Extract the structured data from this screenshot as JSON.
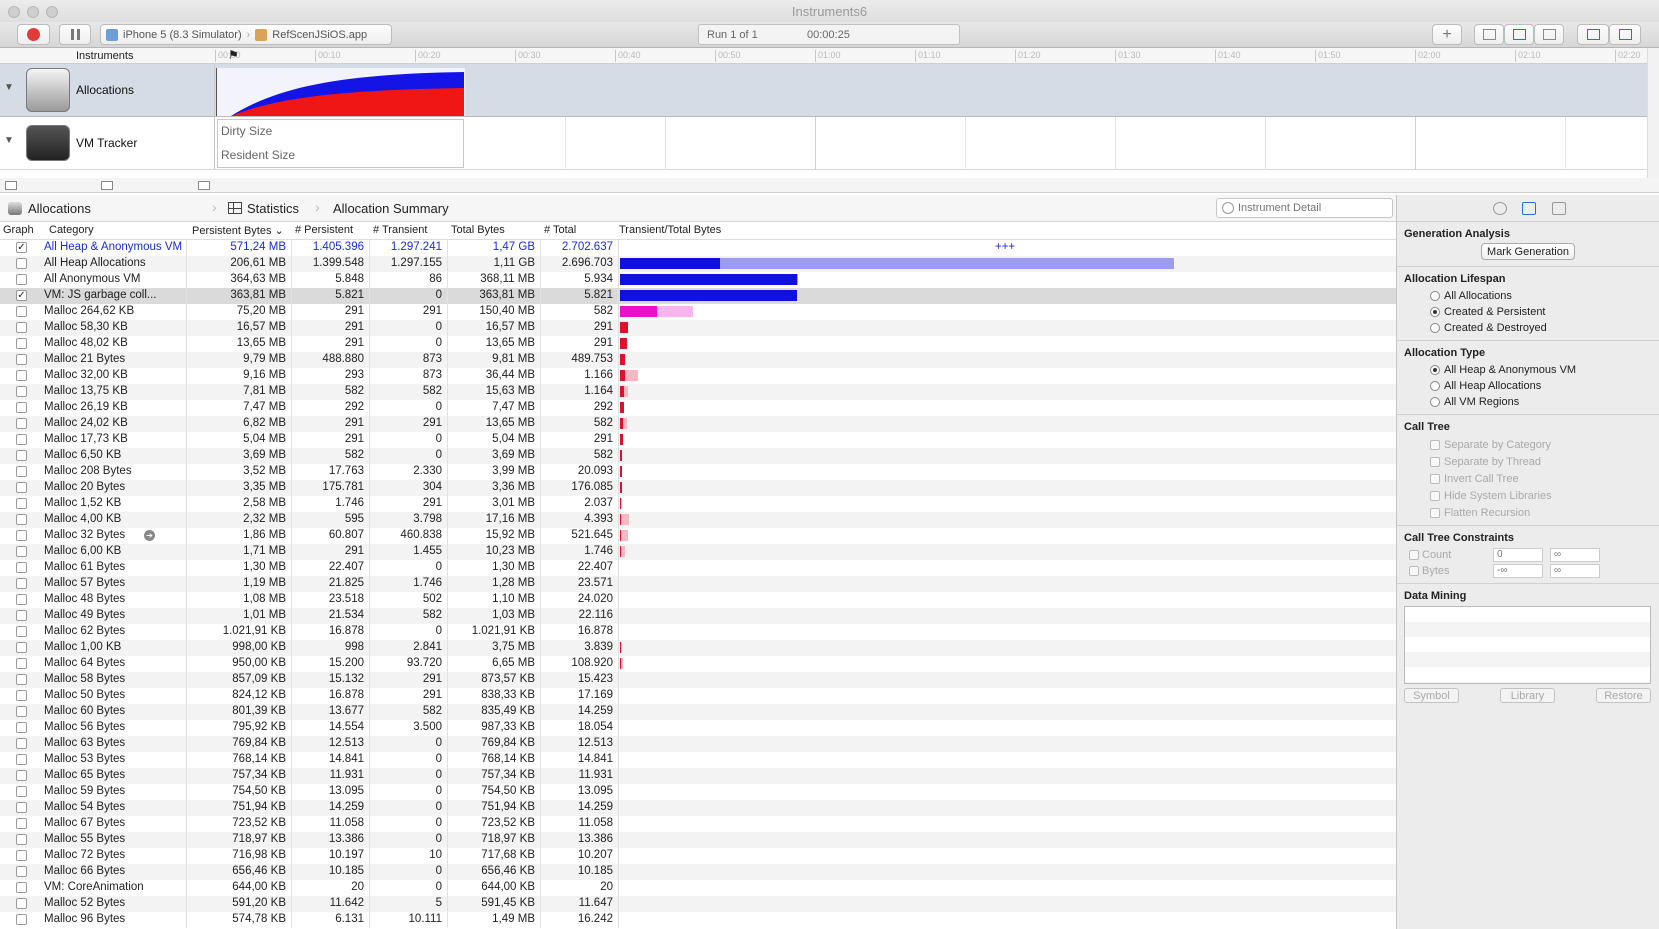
{
  "window": {
    "title": "Instruments6"
  },
  "toolbar": {
    "device": "iPhone 5 (8.3 Simulator)",
    "app": "RefScenJSiOS.app",
    "run_label": "Run 1 of 1",
    "run_time": "00:00:25"
  },
  "timeline": {
    "header": "Instruments",
    "ticks": [
      "00:00",
      "00:10",
      "00:20",
      "00:30",
      "00:40",
      "00:50",
      "01:00",
      "01:10",
      "01:20",
      "01:30",
      "01:40",
      "01:50",
      "02:00",
      "02:10",
      "02:20"
    ],
    "tracks": [
      {
        "name": "Allocations"
      },
      {
        "name": "VM Tracker",
        "labels": [
          "Dirty Size",
          "Resident Size"
        ]
      }
    ]
  },
  "jumpbar": {
    "instrument": "Allocations",
    "view": "Statistics",
    "summary": "Allocation Summary"
  },
  "search": {
    "placeholder": "Instrument Detail"
  },
  "columns": [
    "Graph",
    "Category",
    "Persistent Bytes",
    "# Persistent",
    "# Transient",
    "Total Bytes",
    "# Total",
    "Transient/Total Bytes"
  ],
  "plus_marker": "+++",
  "rows": [
    {
      "checked": true,
      "category": "All Heap & Anonymous VM",
      "persistent_bytes": "571,24 MB",
      "persistent": "1.405.396",
      "transient": "1.297.241",
      "total_bytes": "1,47 GB",
      "total": "2.702.637",
      "highlight": true,
      "bar_dark": 0,
      "bar_light": 0
    },
    {
      "checked": false,
      "category": "All Heap Allocations",
      "persistent_bytes": "206,61 MB",
      "persistent": "1.399.548",
      "transient": "1.297.155",
      "total_bytes": "1,11 GB",
      "total": "2.696.703",
      "color": "blue",
      "bar_dark": 100,
      "bar_light": 554
    },
    {
      "checked": false,
      "category": "All Anonymous VM",
      "persistent_bytes": "364,63 MB",
      "persistent": "5.848",
      "transient": "86",
      "total_bytes": "368,11 MB",
      "total": "5.934",
      "color": "blue",
      "bar_dark": 177,
      "bar_light": 178
    },
    {
      "checked": true,
      "category": "VM: JS garbage coll...",
      "persistent_bytes": "363,81 MB",
      "persistent": "5.821",
      "transient": "0",
      "total_bytes": "363,81 MB",
      "total": "5.821",
      "color": "blue",
      "bar_dark": 177,
      "bar_light": 177,
      "selected": true
    },
    {
      "checked": false,
      "category": "Malloc 264,62 KB",
      "persistent_bytes": "75,20 MB",
      "persistent": "291",
      "transient": "291",
      "total_bytes": "150,40 MB",
      "total": "582",
      "color": "magenta",
      "bar_dark": 37,
      "bar_light": 73
    },
    {
      "checked": false,
      "category": "Malloc 58,30 KB",
      "persistent_bytes": "16,57 MB",
      "persistent": "291",
      "transient": "0",
      "total_bytes": "16,57 MB",
      "total": "291",
      "color": "red",
      "bar_dark": 8,
      "bar_light": 8
    },
    {
      "checked": false,
      "category": "Malloc 48,02 KB",
      "persistent_bytes": "13,65 MB",
      "persistent": "291",
      "transient": "0",
      "total_bytes": "13,65 MB",
      "total": "291",
      "color": "red",
      "bar_dark": 7,
      "bar_light": 7
    },
    {
      "checked": false,
      "category": "Malloc 21 Bytes",
      "persistent_bytes": "9,79 MB",
      "persistent": "488.880",
      "transient": "873",
      "total_bytes": "9,81 MB",
      "total": "489.753",
      "color": "red",
      "bar_dark": 5,
      "bar_light": 5
    },
    {
      "checked": false,
      "category": "Malloc 32,00 KB",
      "persistent_bytes": "9,16 MB",
      "persistent": "293",
      "transient": "873",
      "total_bytes": "36,44 MB",
      "total": "1.166",
      "color": "red",
      "bar_dark": 5,
      "bar_light": 18
    },
    {
      "checked": false,
      "category": "Malloc 13,75 KB",
      "persistent_bytes": "7,81 MB",
      "persistent": "582",
      "transient": "582",
      "total_bytes": "15,63 MB",
      "total": "1.164",
      "color": "red",
      "bar_dark": 4,
      "bar_light": 8
    },
    {
      "checked": false,
      "category": "Malloc 26,19 KB",
      "persistent_bytes": "7,47 MB",
      "persistent": "292",
      "transient": "0",
      "total_bytes": "7,47 MB",
      "total": "292",
      "color": "red",
      "bar_dark": 4,
      "bar_light": 4
    },
    {
      "checked": false,
      "category": "Malloc 24,02 KB",
      "persistent_bytes": "6,82 MB",
      "persistent": "291",
      "transient": "291",
      "total_bytes": "13,65 MB",
      "total": "582",
      "color": "red",
      "bar_dark": 3,
      "bar_light": 7
    },
    {
      "checked": false,
      "category": "Malloc 17,73 KB",
      "persistent_bytes": "5,04 MB",
      "persistent": "291",
      "transient": "0",
      "total_bytes": "5,04 MB",
      "total": "291",
      "color": "red",
      "bar_dark": 3,
      "bar_light": 3
    },
    {
      "checked": false,
      "category": "Malloc 6,50 KB",
      "persistent_bytes": "3,69 MB",
      "persistent": "582",
      "transient": "0",
      "total_bytes": "3,69 MB",
      "total": "582",
      "color": "red",
      "bar_dark": 2,
      "bar_light": 2
    },
    {
      "checked": false,
      "category": "Malloc 208 Bytes",
      "persistent_bytes": "3,52 MB",
      "persistent": "17.763",
      "transient": "2.330",
      "total_bytes": "3,99 MB",
      "total": "20.093",
      "color": "red",
      "bar_dark": 2,
      "bar_light": 2
    },
    {
      "checked": false,
      "category": "Malloc 20 Bytes",
      "persistent_bytes": "3,35 MB",
      "persistent": "175.781",
      "transient": "304",
      "total_bytes": "3,36 MB",
      "total": "176.085",
      "color": "red",
      "bar_dark": 2,
      "bar_light": 2
    },
    {
      "checked": false,
      "category": "Malloc 1,52 KB",
      "persistent_bytes": "2,58 MB",
      "persistent": "1.746",
      "transient": "291",
      "total_bytes": "3,01 MB",
      "total": "2.037",
      "color": "red",
      "bar_dark": 1,
      "bar_light": 2
    },
    {
      "checked": false,
      "category": "Malloc 4,00 KB",
      "persistent_bytes": "2,32 MB",
      "persistent": "595",
      "transient": "3.798",
      "total_bytes": "17,16 MB",
      "total": "4.393",
      "color": "red",
      "bar_dark": 1,
      "bar_light": 9
    },
    {
      "checked": false,
      "category": "Malloc 32 Bytes",
      "persistent_bytes": "1,86 MB",
      "persistent": "60.807",
      "transient": "460.838",
      "total_bytes": "15,92 MB",
      "total": "521.645",
      "color": "red",
      "bar_dark": 1,
      "bar_light": 8,
      "arrow": true
    },
    {
      "checked": false,
      "category": "Malloc 6,00 KB",
      "persistent_bytes": "1,71 MB",
      "persistent": "291",
      "transient": "1.455",
      "total_bytes": "10,23 MB",
      "total": "1.746",
      "color": "red",
      "bar_dark": 1,
      "bar_light": 5
    },
    {
      "checked": false,
      "category": "Malloc 61 Bytes",
      "persistent_bytes": "1,30 MB",
      "persistent": "22.407",
      "transient": "0",
      "total_bytes": "1,30 MB",
      "total": "22.407",
      "color": "red",
      "bar_dark": 0,
      "bar_light": 0
    },
    {
      "checked": false,
      "category": "Malloc 57 Bytes",
      "persistent_bytes": "1,19 MB",
      "persistent": "21.825",
      "transient": "1.746",
      "total_bytes": "1,28 MB",
      "total": "23.571",
      "color": "red",
      "bar_dark": 0,
      "bar_light": 0
    },
    {
      "checked": false,
      "category": "Malloc 48 Bytes",
      "persistent_bytes": "1,08 MB",
      "persistent": "23.518",
      "transient": "502",
      "total_bytes": "1,10 MB",
      "total": "24.020",
      "color": "red",
      "bar_dark": 0,
      "bar_light": 0
    },
    {
      "checked": false,
      "category": "Malloc 49 Bytes",
      "persistent_bytes": "1,01 MB",
      "persistent": "21.534",
      "transient": "582",
      "total_bytes": "1,03 MB",
      "total": "22.116",
      "color": "red",
      "bar_dark": 0,
      "bar_light": 0
    },
    {
      "checked": false,
      "category": "Malloc 62 Bytes",
      "persistent_bytes": "1.021,91 KB",
      "persistent": "16.878",
      "transient": "0",
      "total_bytes": "1.021,91 KB",
      "total": "16.878",
      "color": "red",
      "bar_dark": 0,
      "bar_light": 0
    },
    {
      "checked": false,
      "category": "Malloc 1,00 KB",
      "persistent_bytes": "998,00 KB",
      "persistent": "998",
      "transient": "2.841",
      "total_bytes": "3,75 MB",
      "total": "3.839",
      "color": "red",
      "bar_dark": 0,
      "bar_light": 2
    },
    {
      "checked": false,
      "category": "Malloc 64 Bytes",
      "persistent_bytes": "950,00 KB",
      "persistent": "15.200",
      "transient": "93.720",
      "total_bytes": "6,65 MB",
      "total": "108.920",
      "color": "red",
      "bar_dark": 0,
      "bar_light": 3
    },
    {
      "checked": false,
      "category": "Malloc 58 Bytes",
      "persistent_bytes": "857,09 KB",
      "persistent": "15.132",
      "transient": "291",
      "total_bytes": "873,57 KB",
      "total": "15.423",
      "color": "red",
      "bar_dark": 0,
      "bar_light": 0
    },
    {
      "checked": false,
      "category": "Malloc 50 Bytes",
      "persistent_bytes": "824,12 KB",
      "persistent": "16.878",
      "transient": "291",
      "total_bytes": "838,33 KB",
      "total": "17.169",
      "color": "red",
      "bar_dark": 0,
      "bar_light": 0
    },
    {
      "checked": false,
      "category": "Malloc 60 Bytes",
      "persistent_bytes": "801,39 KB",
      "persistent": "13.677",
      "transient": "582",
      "total_bytes": "835,49 KB",
      "total": "14.259",
      "color": "red",
      "bar_dark": 0,
      "bar_light": 0
    },
    {
      "checked": false,
      "category": "Malloc 56 Bytes",
      "persistent_bytes": "795,92 KB",
      "persistent": "14.554",
      "transient": "3.500",
      "total_bytes": "987,33 KB",
      "total": "18.054",
      "color": "red",
      "bar_dark": 0,
      "bar_light": 0
    },
    {
      "checked": false,
      "category": "Malloc 63 Bytes",
      "persistent_bytes": "769,84 KB",
      "persistent": "12.513",
      "transient": "0",
      "total_bytes": "769,84 KB",
      "total": "12.513",
      "color": "red",
      "bar_dark": 0,
      "bar_light": 0
    },
    {
      "checked": false,
      "category": "Malloc 53 Bytes",
      "persistent_bytes": "768,14 KB",
      "persistent": "14.841",
      "transient": "0",
      "total_bytes": "768,14 KB",
      "total": "14.841",
      "color": "red",
      "bar_dark": 0,
      "bar_light": 0
    },
    {
      "checked": false,
      "category": "Malloc 65 Bytes",
      "persistent_bytes": "757,34 KB",
      "persistent": "11.931",
      "transient": "0",
      "total_bytes": "757,34 KB",
      "total": "11.931",
      "color": "red",
      "bar_dark": 0,
      "bar_light": 0
    },
    {
      "checked": false,
      "category": "Malloc 59 Bytes",
      "persistent_bytes": "754,50 KB",
      "persistent": "13.095",
      "transient": "0",
      "total_bytes": "754,50 KB",
      "total": "13.095",
      "color": "red",
      "bar_dark": 0,
      "bar_light": 0
    },
    {
      "checked": false,
      "category": "Malloc 54 Bytes",
      "persistent_bytes": "751,94 KB",
      "persistent": "14.259",
      "transient": "0",
      "total_bytes": "751,94 KB",
      "total": "14.259",
      "color": "red",
      "bar_dark": 0,
      "bar_light": 0
    },
    {
      "checked": false,
      "category": "Malloc 67 Bytes",
      "persistent_bytes": "723,52 KB",
      "persistent": "11.058",
      "transient": "0",
      "total_bytes": "723,52 KB",
      "total": "11.058",
      "color": "red",
      "bar_dark": 0,
      "bar_light": 0
    },
    {
      "checked": false,
      "category": "Malloc 55 Bytes",
      "persistent_bytes": "718,97 KB",
      "persistent": "13.386",
      "transient": "0",
      "total_bytes": "718,97 KB",
      "total": "13.386",
      "color": "red",
      "bar_dark": 0,
      "bar_light": 0
    },
    {
      "checked": false,
      "category": "Malloc 72 Bytes",
      "persistent_bytes": "716,98 KB",
      "persistent": "10.197",
      "transient": "10",
      "total_bytes": "717,68 KB",
      "total": "10.207",
      "color": "red",
      "bar_dark": 0,
      "bar_light": 0
    },
    {
      "checked": false,
      "category": "Malloc 66 Bytes",
      "persistent_bytes": "656,46 KB",
      "persistent": "10.185",
      "transient": "0",
      "total_bytes": "656,46 KB",
      "total": "10.185",
      "color": "red",
      "bar_dark": 0,
      "bar_light": 0
    },
    {
      "checked": false,
      "category": "VM: CoreAnimation",
      "persistent_bytes": "644,00 KB",
      "persistent": "20",
      "transient": "0",
      "total_bytes": "644,00 KB",
      "total": "20",
      "color": "red",
      "bar_dark": 0,
      "bar_light": 0
    },
    {
      "checked": false,
      "category": "Malloc 52 Bytes",
      "persistent_bytes": "591,20 KB",
      "persistent": "11.642",
      "transient": "5",
      "total_bytes": "591,45 KB",
      "total": "11.647",
      "color": "red",
      "bar_dark": 0,
      "bar_light": 0
    },
    {
      "checked": false,
      "category": "Malloc 96 Bytes",
      "persistent_bytes": "574,78 KB",
      "persistent": "6.131",
      "transient": "10.111",
      "total_bytes": "1,49 MB",
      "total": "16.242",
      "color": "red",
      "bar_dark": 0,
      "bar_light": 0
    }
  ],
  "colors": {
    "blue_dark": "#1010e0",
    "blue_light": "#9c9cf0",
    "magenta_dark": "#f00fc8",
    "magenta_light": "#f8b4ec",
    "red_dark": "#e0102a",
    "red_light": "#f6b8c2",
    "highlight_text": "#1a2bd8"
  },
  "inspector": {
    "generation": {
      "title": "Generation Analysis",
      "button": "Mark Generation"
    },
    "lifespan": {
      "title": "Allocation Lifespan",
      "options": [
        "All Allocations",
        "Created & Persistent",
        "Created & Destroyed"
      ],
      "selected": 1
    },
    "type": {
      "title": "Allocation Type",
      "options": [
        "All Heap & Anonymous VM",
        "All Heap Allocations",
        "All VM Regions"
      ],
      "selected": 0
    },
    "calltree": {
      "title": "Call Tree",
      "options": [
        "Separate by Category",
        "Separate by Thread",
        "Invert Call Tree",
        "Hide System Libraries",
        "Flatten Recursion"
      ]
    },
    "constraints": {
      "title": "Call Tree Constraints",
      "count_label": "Count",
      "bytes_label": "Bytes",
      "count_min": "0",
      "count_max": "∞",
      "bytes_min": "-∞",
      "bytes_max": "∞"
    },
    "datamining": {
      "title": "Data Mining",
      "buttons": [
        "Symbol",
        "Library",
        "Restore"
      ]
    }
  }
}
